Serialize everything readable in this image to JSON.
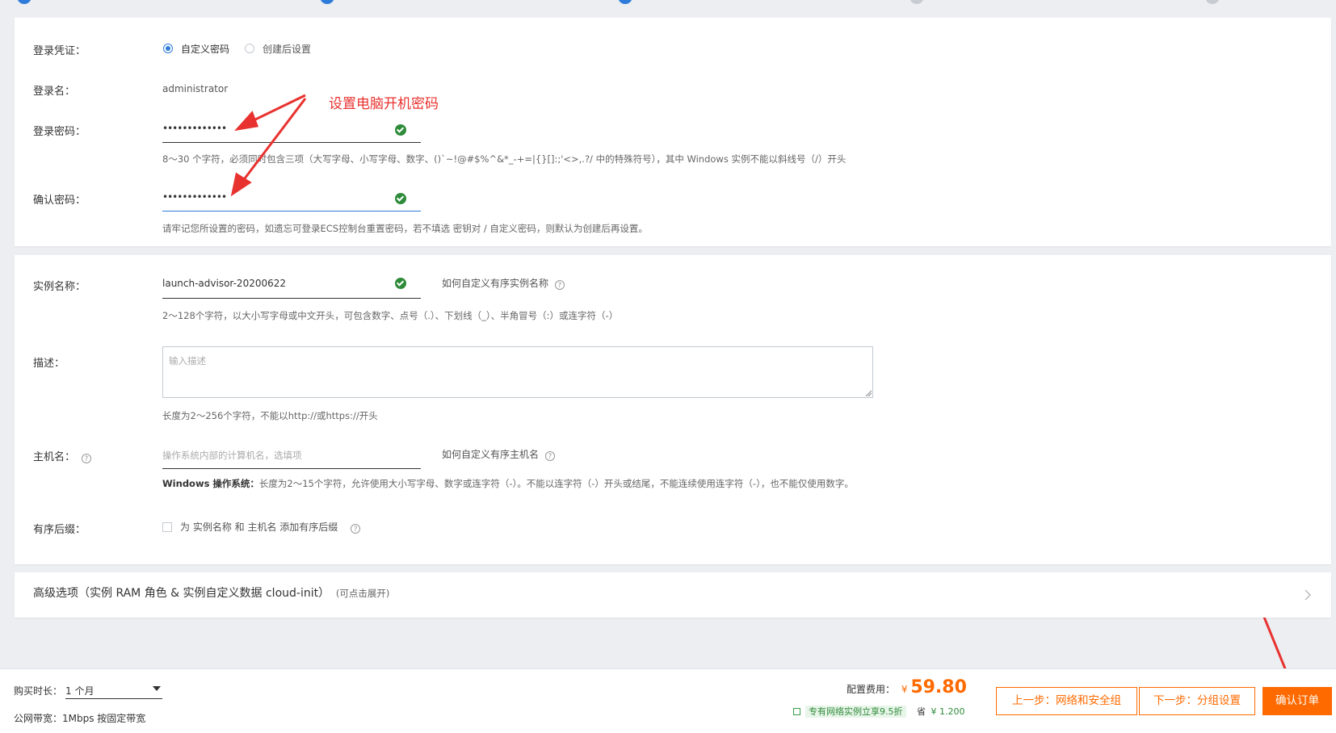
{
  "annotation": {
    "text": "设置电脑开机密码",
    "color": "#e8322f"
  },
  "colors": {
    "accent": "#ff6a00",
    "success": "#2e8b3a",
    "link": "#2e7bd9"
  },
  "login": {
    "credential_label": "登录凭证：",
    "credential_options": [
      {
        "label": "自定义密码",
        "selected": true
      },
      {
        "label": "创建后设置",
        "selected": false
      }
    ],
    "username_label": "登录名：",
    "username_value": "administrator",
    "password_label": "登录密码：",
    "password_value": "•••••••••••••",
    "password_hint": "8～30 个字符，必须同时包含三项（大写字母、小写字母、数字、()`~!@#$%^&*_-+=|{}[]:;'<>,.?/ 中的特殊符号），其中 Windows 实例不能以斜线号（/）开头",
    "confirm_label": "确认密码：",
    "confirm_value": "•••••••••••••",
    "confirm_hint": "请牢记您所设置的密码，如遗忘可登录ECS控制台重置密码，若不填选 密钥对 / 自定义密码，则默认为创建后再设置。"
  },
  "instance": {
    "name_label": "实例名称：",
    "name_value": "launch-advisor-20200622",
    "name_help": "如何自定义有序实例名称",
    "name_hint": "2～128个字符，以大小写字母或中文开头，可包含数字、点号（.）、下划线（_）、半角冒号（:）或连字符（-）",
    "desc_label": "描述：",
    "desc_placeholder": "输入描述",
    "desc_hint": "长度为2～256个字符，不能以http://或https://开头",
    "host_label": "主机名：",
    "host_placeholder": "操作系统内部的计算机名，选填项",
    "host_help": "如何自定义有序主机名",
    "host_hint_bold": "Windows 操作系统：",
    "host_hint": "长度为2～15个字符，允许使用大小写字母、数字或连字符（-）。不能以连字符（-）开头或结尾，不能连续使用连字符（-），也不能仅使用数字。",
    "suffix_label": "有序后缀：",
    "suffix_text": "为 实例名称 和 主机名 添加有序后缀"
  },
  "advanced": {
    "title": "高级选项（实例 RAM 角色 & 实例自定义数据 cloud-init）",
    "hint": "(可点击展开)"
  },
  "footer": {
    "duration_label": "购买时长：",
    "duration_value": "1 个月",
    "bandwidth_label": "公网带宽：",
    "bandwidth_value": "1Mbps 按固定带宽",
    "fee_label": "配置费用：",
    "currency": "¥",
    "price": "59.80",
    "discount_badge": "专有网络实例立享9.5折",
    "save_label": "省",
    "save_value": "¥ 1.200",
    "prev_button": "上一步：网络和安全组",
    "next_button": "下一步：分组设置",
    "confirm_button": "确认订单"
  }
}
